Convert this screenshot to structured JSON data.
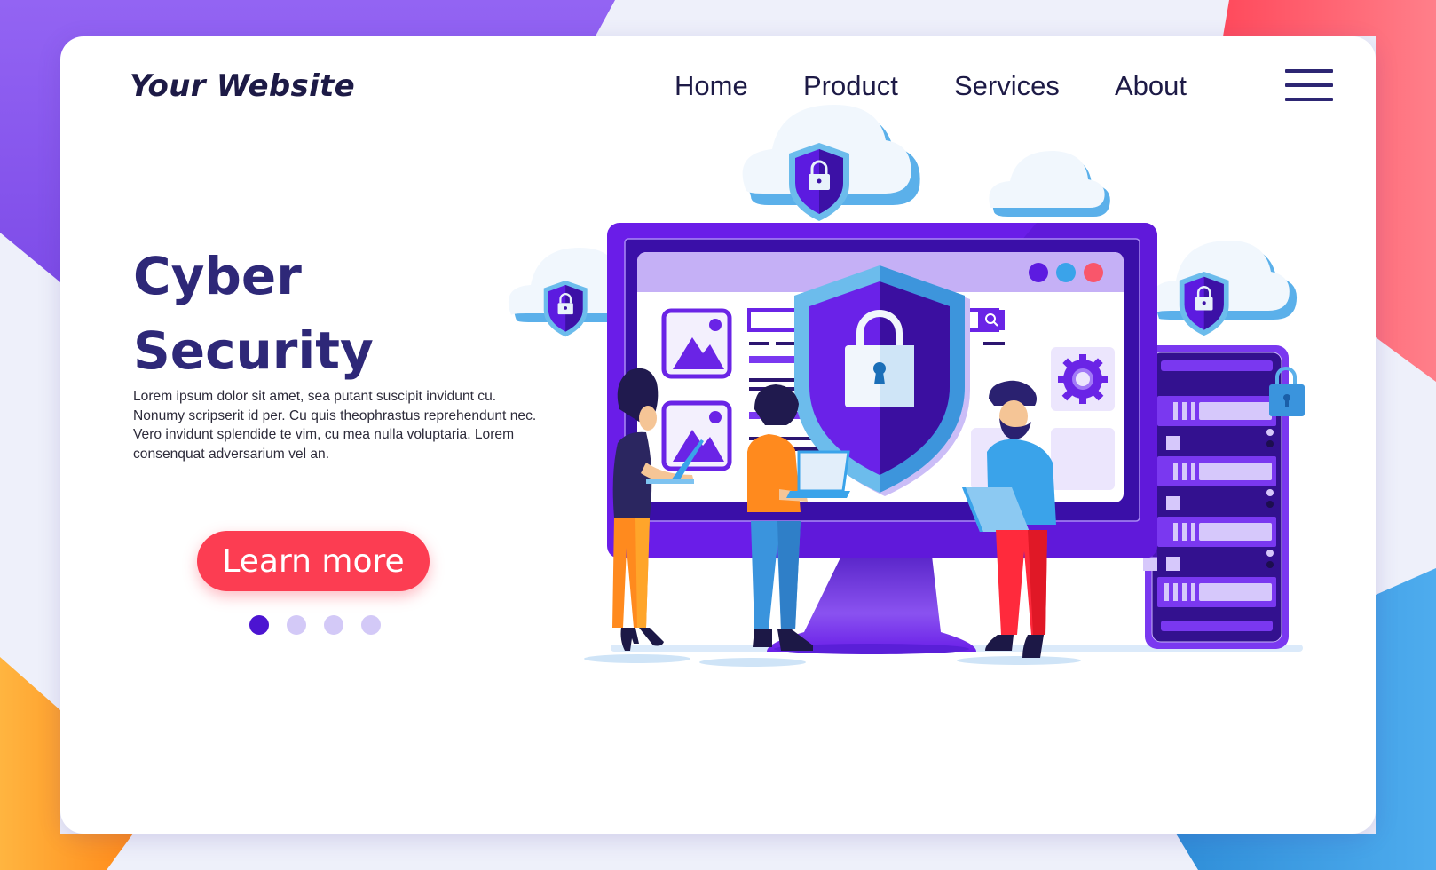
{
  "header": {
    "brand": "Your Website",
    "nav": [
      {
        "label": "Home"
      },
      {
        "label": "Product"
      },
      {
        "label": "Services"
      },
      {
        "label": "About"
      }
    ],
    "menu_icon": "hamburger-menu-icon"
  },
  "hero": {
    "title_line1": "Cyber",
    "title_line2": "Security",
    "body": "Lorem ipsum dolor sit amet, sea putant suscipit invidunt cu. Nonumy scripserit id per. Cu quis theophrastus reprehendunt nec. Vero invidunt splendide te vim, cu mea nulla voluptaria. Lorem consenquat adversarium vel an.",
    "cta_label": "Learn more"
  },
  "carousel": {
    "total": 4,
    "active_index": 0
  },
  "illustration": {
    "subject": "cyber-security-monitor-with-shield",
    "icons": [
      "cloud-lock-icon",
      "shield-lock-icon",
      "server-icon",
      "padlock-icon",
      "gear-icon",
      "image-icon",
      "search-icon"
    ]
  },
  "colors": {
    "primary": "#4c14d1",
    "heading": "#2e2878",
    "text": "#1d1a46",
    "cta": "#fc3d52",
    "dot_inactive": "#d3c9f7",
    "bg_purple": "#8e5ff2",
    "bg_red": "#ff6575",
    "bg_orange": "#ffb03c",
    "bg_blue": "#4aa8ea"
  }
}
